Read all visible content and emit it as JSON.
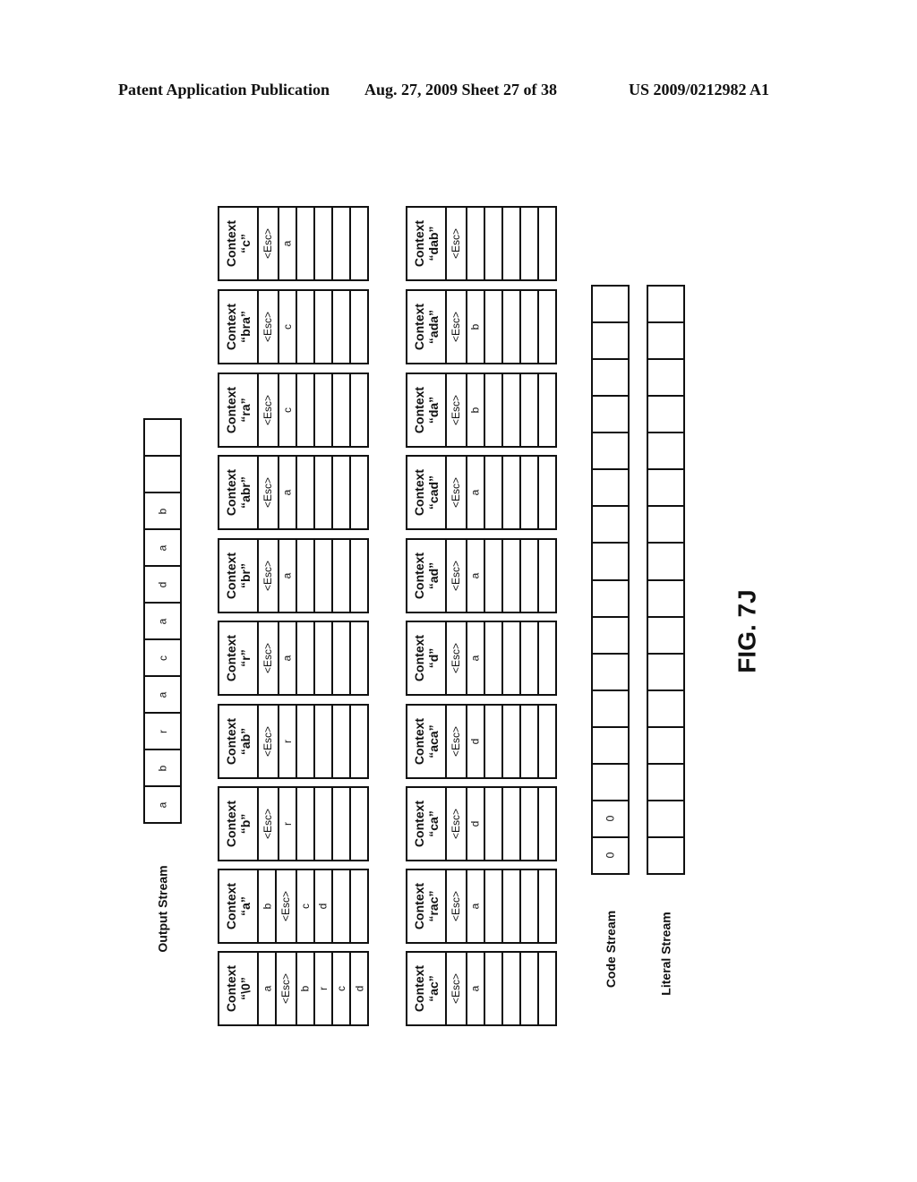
{
  "header": {
    "left": "Patent Application Publication",
    "middle": "Aug. 27, 2009  Sheet 27 of 38",
    "right": "US 2009/0212982 A1"
  },
  "output_stream": {
    "label": "Output Stream",
    "cells": [
      "a",
      "b",
      "r",
      "a",
      "c",
      "a",
      "d",
      "a",
      "b",
      "",
      ""
    ]
  },
  "context_tables": {
    "row1": [
      {
        "title": "Context",
        "name": "“\\0”",
        "cells": [
          "a",
          "<Esc>",
          "b",
          "r",
          "c",
          "d"
        ]
      },
      {
        "title": "Context",
        "name": "“a”",
        "cells": [
          "b",
          "<Esc>",
          "c",
          "d",
          "",
          ""
        ]
      },
      {
        "title": "Context",
        "name": "“b”",
        "cells": [
          "<Esc>",
          "r",
          "",
          "",
          "",
          ""
        ]
      },
      {
        "title": "Context",
        "name": "“ab”",
        "cells": [
          "<Esc>",
          "r",
          "",
          "",
          "",
          ""
        ]
      },
      {
        "title": "Context",
        "name": "“r”",
        "cells": [
          "<Esc>",
          "a",
          "",
          "",
          "",
          ""
        ]
      },
      {
        "title": "Context",
        "name": "“br”",
        "cells": [
          "<Esc>",
          "a",
          "",
          "",
          "",
          ""
        ]
      },
      {
        "title": "Context",
        "name": "“abr”",
        "cells": [
          "<Esc>",
          "a",
          "",
          "",
          "",
          ""
        ]
      },
      {
        "title": "Context",
        "name": "“ra”",
        "cells": [
          "<Esc>",
          "c",
          "",
          "",
          "",
          ""
        ]
      },
      {
        "title": "Context",
        "name": "“bra”",
        "cells": [
          "<Esc>",
          "c",
          "",
          "",
          "",
          ""
        ]
      },
      {
        "title": "Context",
        "name": "“c”",
        "cells": [
          "<Esc>",
          "a",
          "",
          "",
          "",
          ""
        ]
      }
    ],
    "row2": [
      {
        "title": "Context",
        "name": "“ac”",
        "cells": [
          "<Esc>",
          "a",
          "",
          "",
          "",
          ""
        ]
      },
      {
        "title": "Context",
        "name": "“rac”",
        "cells": [
          "<Esc>",
          "a",
          "",
          "",
          "",
          ""
        ]
      },
      {
        "title": "Context",
        "name": "“ca”",
        "cells": [
          "<Esc>",
          "d",
          "",
          "",
          "",
          ""
        ]
      },
      {
        "title": "Context",
        "name": "“aca”",
        "cells": [
          "<Esc>",
          "d",
          "",
          "",
          "",
          ""
        ]
      },
      {
        "title": "Context",
        "name": "“d”",
        "cells": [
          "<Esc>",
          "a",
          "",
          "",
          "",
          ""
        ]
      },
      {
        "title": "Context",
        "name": "“ad”",
        "cells": [
          "<Esc>",
          "a",
          "",
          "",
          "",
          ""
        ]
      },
      {
        "title": "Context",
        "name": "“cad”",
        "cells": [
          "<Esc>",
          "a",
          "",
          "",
          "",
          ""
        ]
      },
      {
        "title": "Context",
        "name": "“da”",
        "cells": [
          "<Esc>",
          "b",
          "",
          "",
          "",
          ""
        ]
      },
      {
        "title": "Context",
        "name": "“ada”",
        "cells": [
          "<Esc>",
          "b",
          "",
          "",
          "",
          ""
        ]
      },
      {
        "title": "Context",
        "name": "“dab”",
        "cells": [
          "<Esc>",
          "",
          "",
          "",
          "",
          ""
        ]
      }
    ]
  },
  "code_stream": {
    "label": "Code Stream",
    "cells": [
      "0",
      "0",
      "",
      "",
      "",
      "",
      "",
      "",
      "",
      "",
      "",
      "",
      "",
      "",
      "",
      ""
    ]
  },
  "literal_stream": {
    "label": "Literal Stream",
    "cells": [
      "",
      "",
      "",
      "",
      "",
      "",
      "",
      "",
      "",
      "",
      "",
      "",
      "",
      "",
      "",
      ""
    ]
  },
  "figure_label": "FIG. 7J"
}
